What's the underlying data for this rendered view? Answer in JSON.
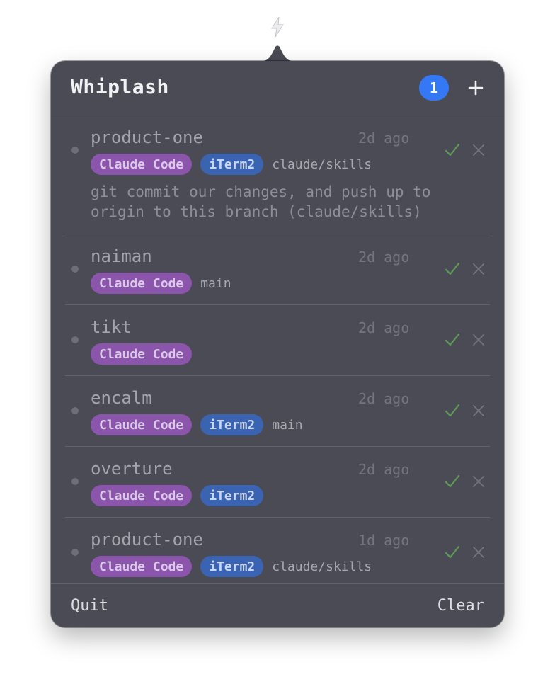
{
  "app": {
    "title": "Whiplash",
    "count": "1",
    "icons": {
      "menubar": "bolt-icon",
      "add": "plus-icon",
      "confirm": "check-icon",
      "dismiss": "x-icon"
    },
    "colors": {
      "accent": "#3478f6",
      "claude_tag": "#8a55ab",
      "iterm_tag": "#3a63b2",
      "check": "#5c9a55",
      "panel": "#4b4b55"
    }
  },
  "sessions": [
    {
      "name": "product-one",
      "time": "2d ago",
      "tags": [
        "Claude Code",
        "iTerm2"
      ],
      "branch": "claude/skills",
      "message": "git commit our changes, and push up to\norigin to this branch (claude/skills)"
    },
    {
      "name": "naiman",
      "time": "2d ago",
      "tags": [
        "Claude Code"
      ],
      "branch": "main"
    },
    {
      "name": "tikt",
      "time": "2d ago",
      "tags": [
        "Claude Code"
      ],
      "branch": ""
    },
    {
      "name": "encalm",
      "time": "2d ago",
      "tags": [
        "Claude Code",
        "iTerm2"
      ],
      "branch": "main"
    },
    {
      "name": "overture",
      "time": "2d ago",
      "tags": [
        "Claude Code",
        "iTerm2"
      ],
      "branch": ""
    },
    {
      "name": "product-one",
      "time": "1d ago",
      "tags": [
        "Claude Code",
        "iTerm2"
      ],
      "branch": "claude/skills"
    }
  ],
  "footer": {
    "quit_label": "Quit",
    "clear_label": "Clear"
  }
}
